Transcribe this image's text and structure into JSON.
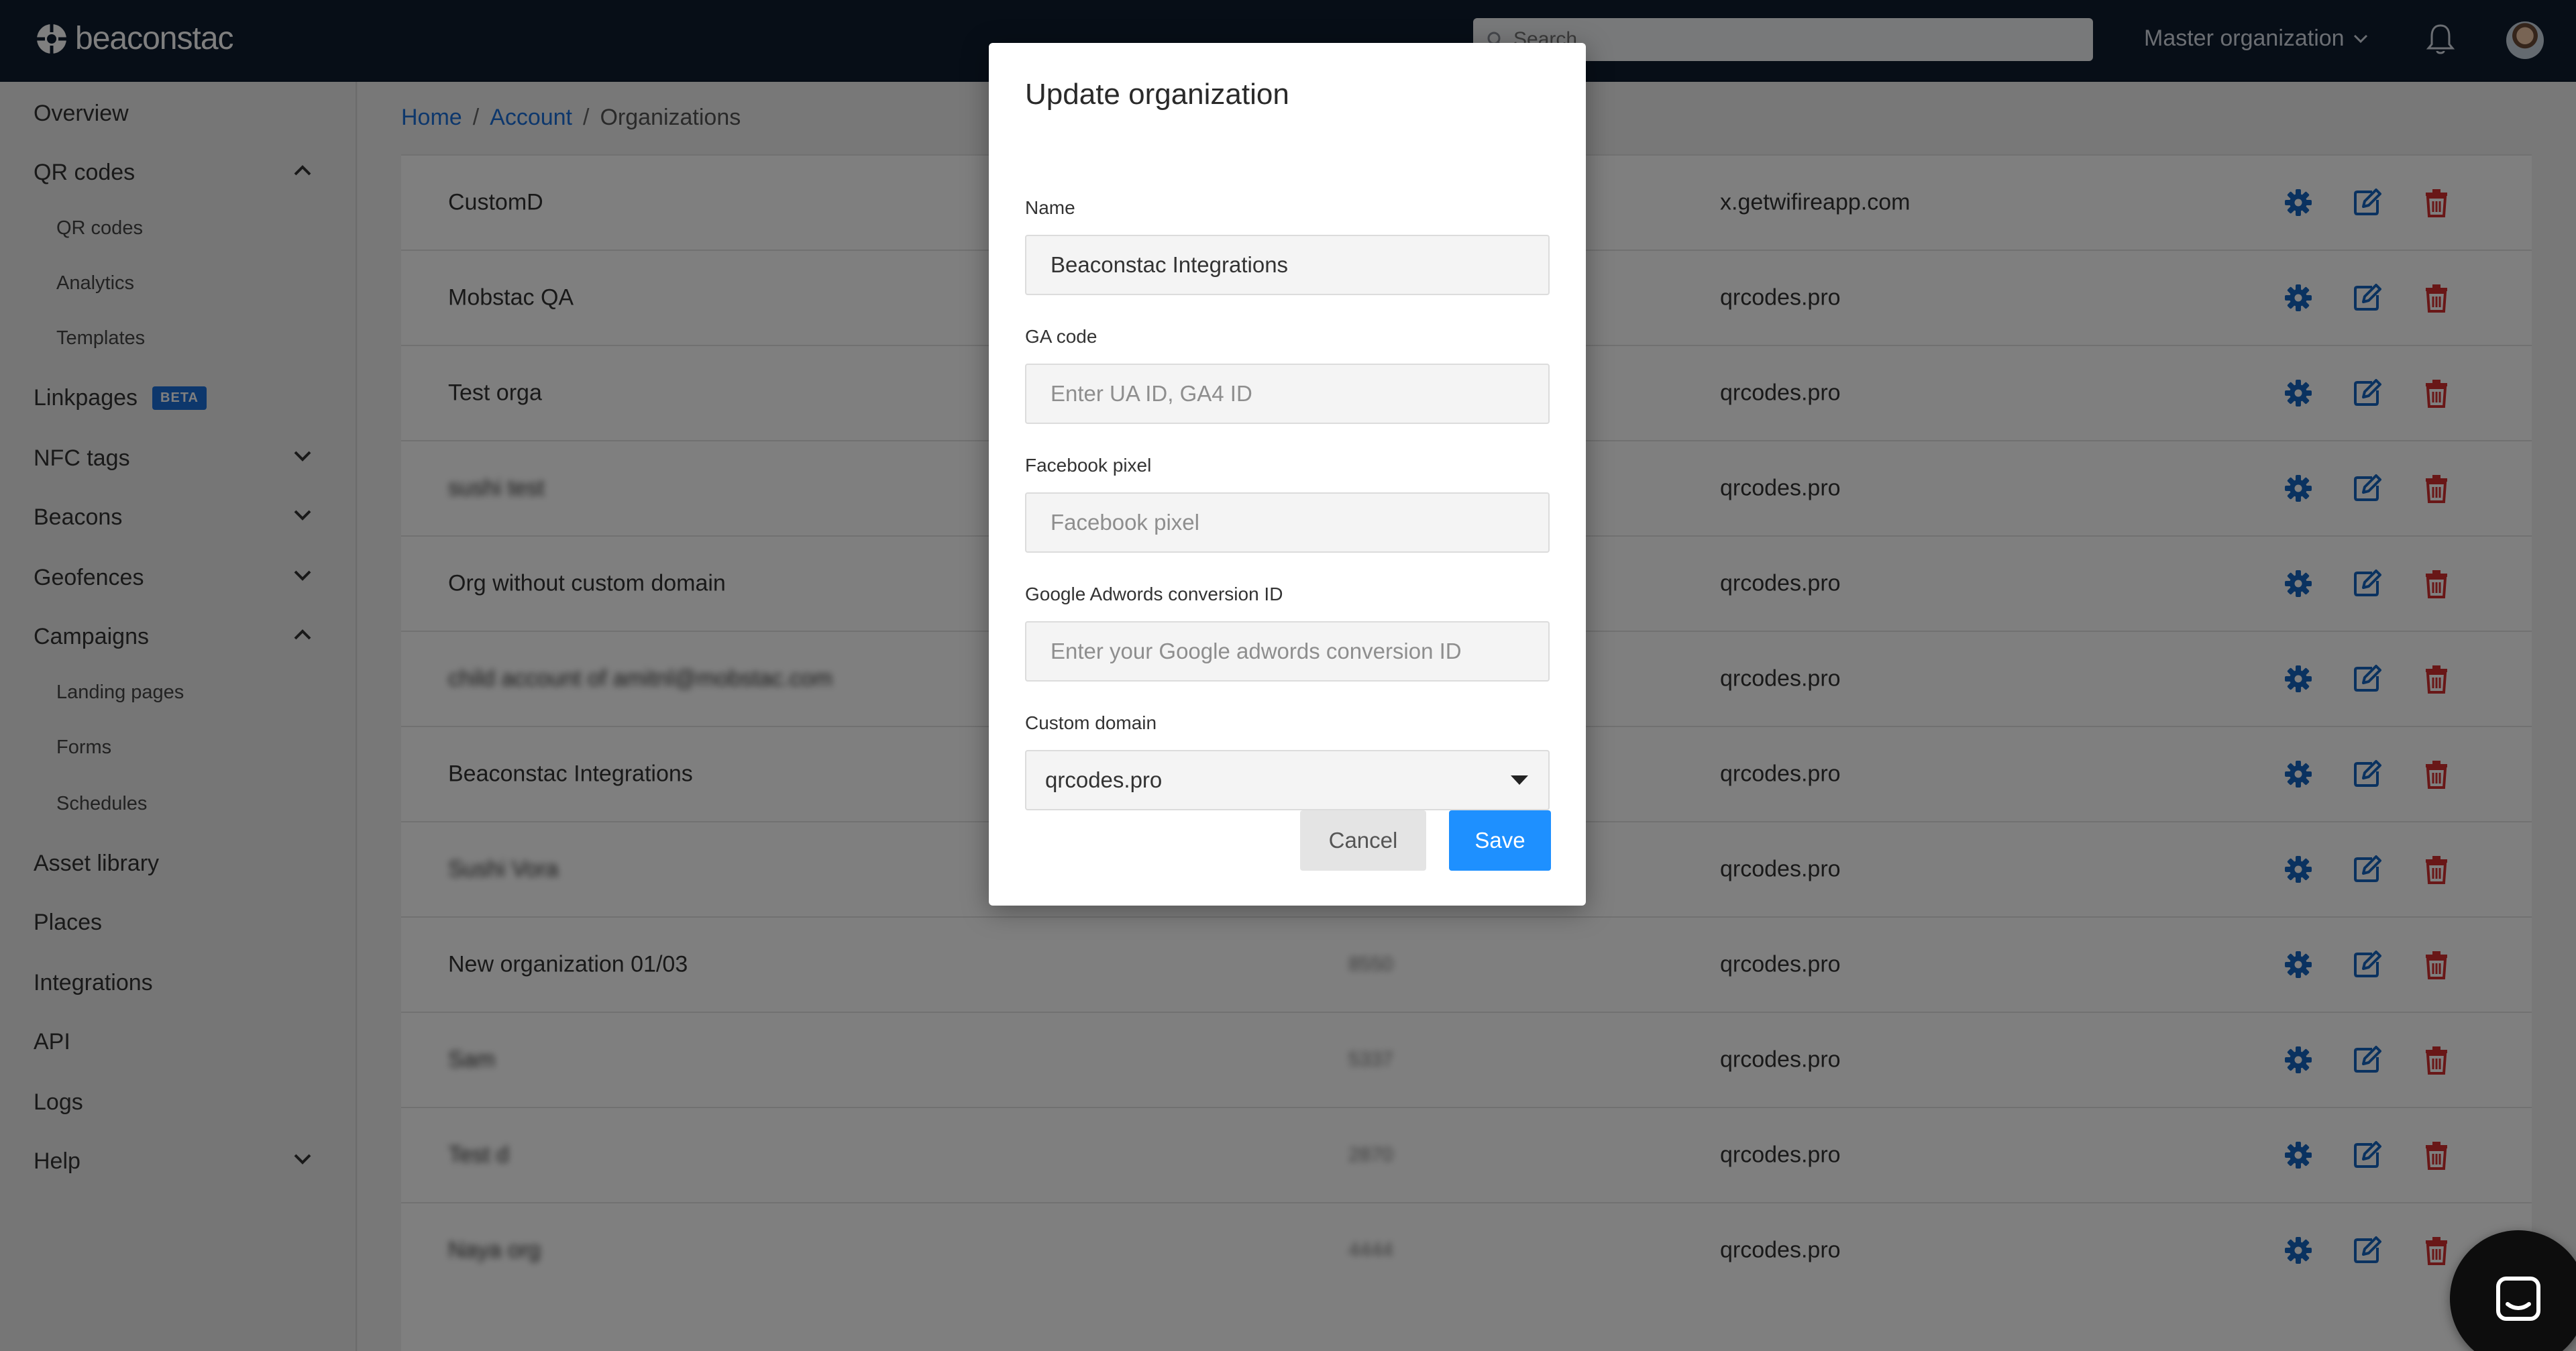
{
  "header": {
    "logo_text": "beaconstac",
    "search_placeholder": "Search",
    "org_switcher": "Master organization"
  },
  "sidebar": {
    "items": [
      {
        "label": "Overview"
      },
      {
        "label": "QR codes",
        "expanded": true,
        "children": [
          "QR codes",
          "Analytics",
          "Templates"
        ]
      },
      {
        "label": "Linkpages",
        "badge": "BETA"
      },
      {
        "label": "NFC tags",
        "expanded": false
      },
      {
        "label": "Beacons",
        "expanded": false
      },
      {
        "label": "Geofences",
        "expanded": false
      },
      {
        "label": "Campaigns",
        "expanded": true,
        "children": [
          "Landing pages",
          "Forms",
          "Schedules"
        ]
      },
      {
        "label": "Asset library"
      },
      {
        "label": "Places"
      },
      {
        "label": "Integrations"
      },
      {
        "label": "API"
      },
      {
        "label": "Logs"
      },
      {
        "label": "Help",
        "expanded": false
      }
    ]
  },
  "breadcrumb": {
    "home": "Home",
    "account": "Account",
    "current": "Organizations",
    "separator": "/"
  },
  "table": {
    "rows": [
      {
        "name": "CustomD",
        "id": "",
        "domain": "x.getwifireapp.com",
        "blurred": false
      },
      {
        "name": "Mobstac QA",
        "id": "",
        "domain": "qrcodes.pro",
        "blurred": false
      },
      {
        "name": "Test orga",
        "id": "",
        "domain": "qrcodes.pro",
        "blurred": false
      },
      {
        "name": "sushi test",
        "id": "",
        "domain": "qrcodes.pro",
        "blurred": true
      },
      {
        "name": "Org without custom domain",
        "id": "",
        "domain": "qrcodes.pro",
        "blurred": false
      },
      {
        "name": "child account of amitnl@mobstac.com",
        "id": "",
        "domain": "qrcodes.pro",
        "blurred": true
      },
      {
        "name": "Beaconstac Integrations",
        "id": "",
        "domain": "qrcodes.pro",
        "blurred": false
      },
      {
        "name": "Sushi Vora",
        "id": "",
        "domain": "qrcodes.pro",
        "blurred": true
      },
      {
        "name": "New organization 01/03",
        "id": "8550",
        "domain": "qrcodes.pro",
        "blurred": false
      },
      {
        "name": "Sam",
        "id": "5337",
        "domain": "qrcodes.pro",
        "blurred": true
      },
      {
        "name": "Test d",
        "id": "2870",
        "domain": "qrcodes.pro",
        "blurred": true
      },
      {
        "name": "Naya org",
        "id": "4444",
        "domain": "qrcodes.pro",
        "blurred": true
      }
    ]
  },
  "modal": {
    "title": "Update organization",
    "name_label": "Name",
    "name_value": "Beaconstac Integrations",
    "ga_label": "GA code",
    "ga_placeholder": "Enter UA ID, GA4 ID",
    "fb_label": "Facebook pixel",
    "fb_placeholder": "Facebook pixel",
    "adwords_label": "Google Adwords conversion ID",
    "adwords_placeholder": "Enter your Google adwords conversion ID",
    "domain_label": "Custom domain",
    "domain_value": "qrcodes.pro",
    "cancel_label": "Cancel",
    "save_label": "Save"
  },
  "colors": {
    "topbar": "#0f1d2f",
    "link": "#1a6fd8",
    "primary_button": "#1e90ff",
    "gear_icon": "#1565c0",
    "edit_icon": "#1565c0",
    "delete_icon": "#d32f2f"
  }
}
